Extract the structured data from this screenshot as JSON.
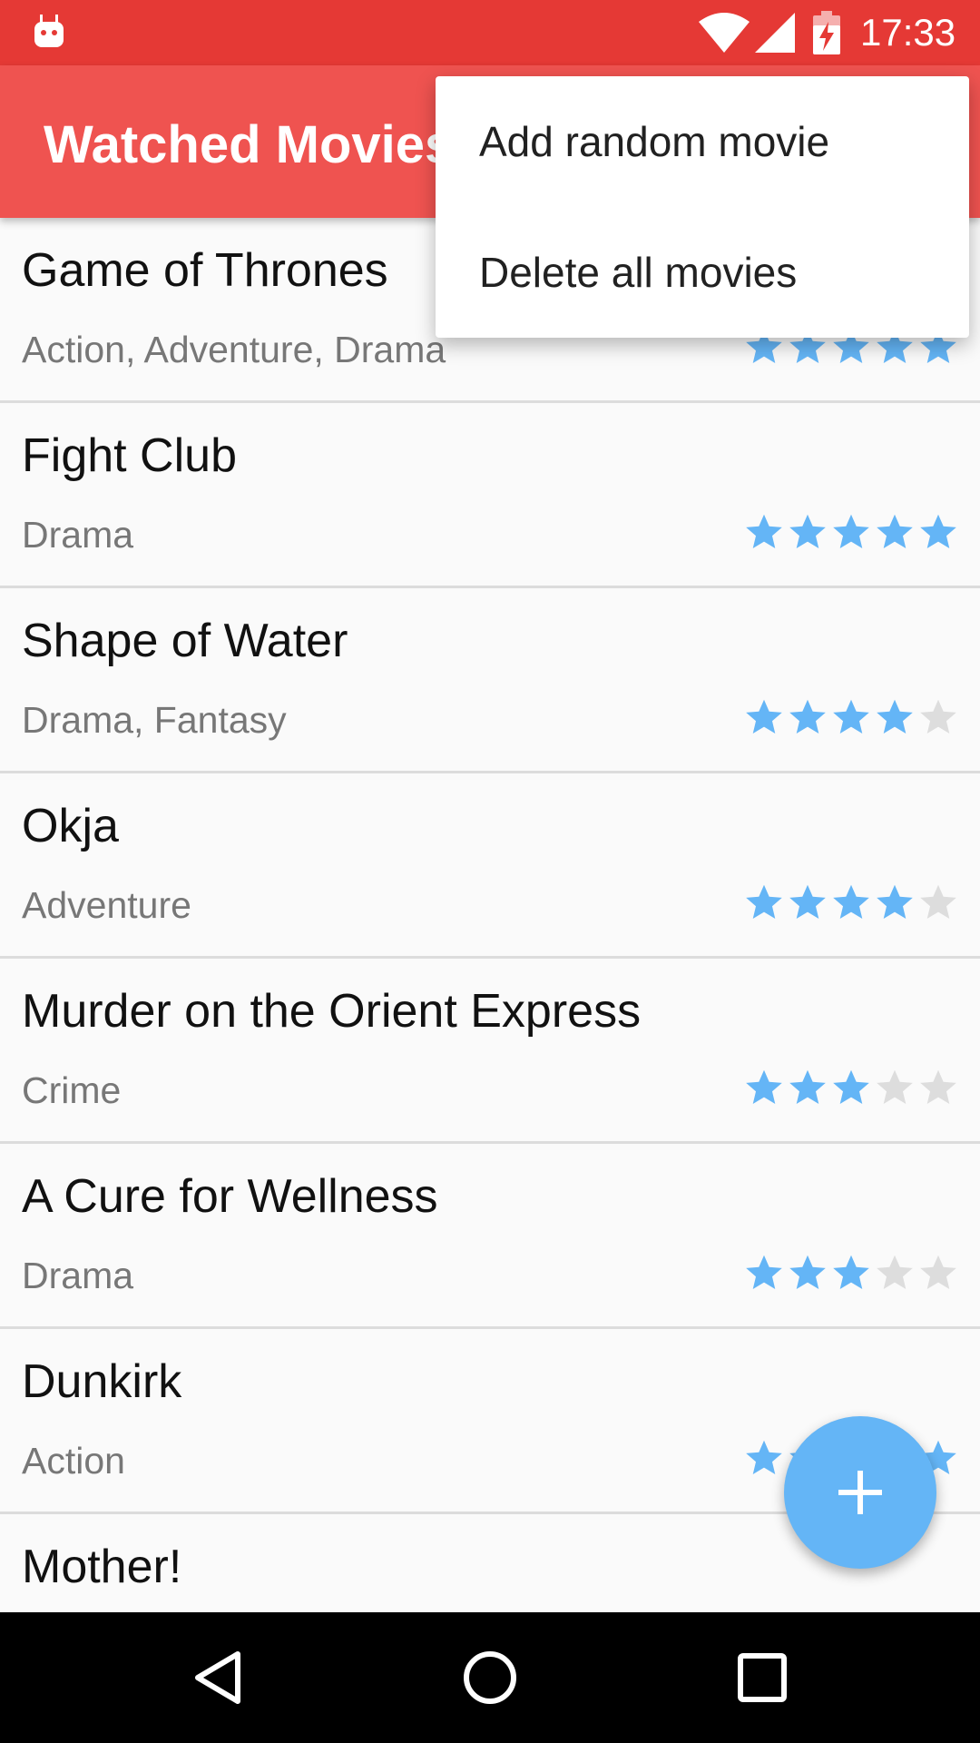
{
  "status_bar": {
    "time": "17:33",
    "icons": [
      "android-debug-icon",
      "wifi-icon",
      "signal-icon",
      "battery-charging-icon"
    ]
  },
  "app_bar": {
    "title": "Watched Movies"
  },
  "menu": {
    "items": [
      {
        "label": "Add random movie"
      },
      {
        "label": "Delete all movies"
      }
    ]
  },
  "movies": [
    {
      "title": "Game of Thrones",
      "genre": "Action, Adventure, Drama",
      "rating": 5
    },
    {
      "title": "Fight Club",
      "genre": "Drama",
      "rating": 5
    },
    {
      "title": "Shape of Water",
      "genre": "Drama, Fantasy",
      "rating": 4
    },
    {
      "title": "Okja",
      "genre": "Adventure",
      "rating": 4
    },
    {
      "title": "Murder on the Orient Express",
      "genre": "Crime",
      "rating": 3
    },
    {
      "title": "A Cure for Wellness",
      "genre": "Drama",
      "rating": 3
    },
    {
      "title": "Dunkirk",
      "genre": "Action",
      "rating": 5
    },
    {
      "title": "Mother!",
      "genre": "",
      "rating": 0
    }
  ],
  "rating_max": 5,
  "fab": {
    "icon": "plus-icon"
  },
  "nav_bar": {
    "buttons": [
      "back-icon",
      "home-icon",
      "recents-icon"
    ]
  },
  "colors": {
    "status_bar": "#e53935",
    "app_bar": "#ef5350",
    "accent": "#64b5f6",
    "star_off": "#dddddd"
  }
}
